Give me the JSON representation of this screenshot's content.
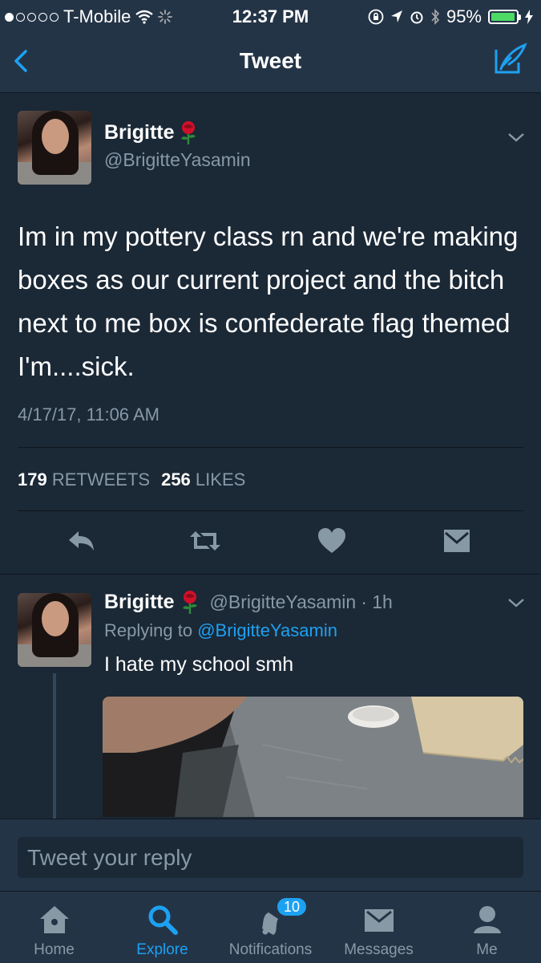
{
  "status_bar": {
    "carrier": "T-Mobile",
    "time": "12:37 PM",
    "battery": "95%",
    "battery_level": 0.95,
    "signal_bars_filled": 1,
    "signal_bars_total": 5
  },
  "nav": {
    "title": "Tweet",
    "back_icon": "chevron-left-icon",
    "compose_icon": "compose-quill-icon"
  },
  "main_tweet": {
    "display_name": "Brigitte",
    "handle": "@BrigitteYasamin",
    "text": "Im in my pottery class rn and we're making boxes as our current project and the bitch next to me box is confederate flag themed I'm....sick.",
    "timestamp": "4/17/17, 11:06 AM",
    "retweets_count": "179",
    "retweets_label": "RETWEETS",
    "likes_count": "256",
    "likes_label": "LIKES",
    "actions": [
      "reply-icon",
      "retweet-icon",
      "like-icon",
      "direct-message-icon"
    ]
  },
  "reply": {
    "display_name": "Brigitte",
    "handle": "@BrigitteYasamin",
    "age": "· 1h",
    "replying_prefix": "Replying to",
    "replying_to": "@BrigitteYasamin",
    "text": "I hate my school smh"
  },
  "reply_bar": {
    "placeholder": "Tweet your reply"
  },
  "tab_bar": {
    "tabs": [
      {
        "label": "Home",
        "icon": "home-icon"
      },
      {
        "label": "Explore",
        "icon": "search-icon",
        "active": true
      },
      {
        "label": "Notifications",
        "icon": "bell-icon",
        "badge": "10"
      },
      {
        "label": "Messages",
        "icon": "envelope-icon"
      },
      {
        "label": "Me",
        "icon": "person-icon"
      }
    ]
  },
  "colors": {
    "background": "#1b2836",
    "bar": "#243447",
    "accent": "#1da1f2",
    "secondary_text": "#8899a6"
  }
}
